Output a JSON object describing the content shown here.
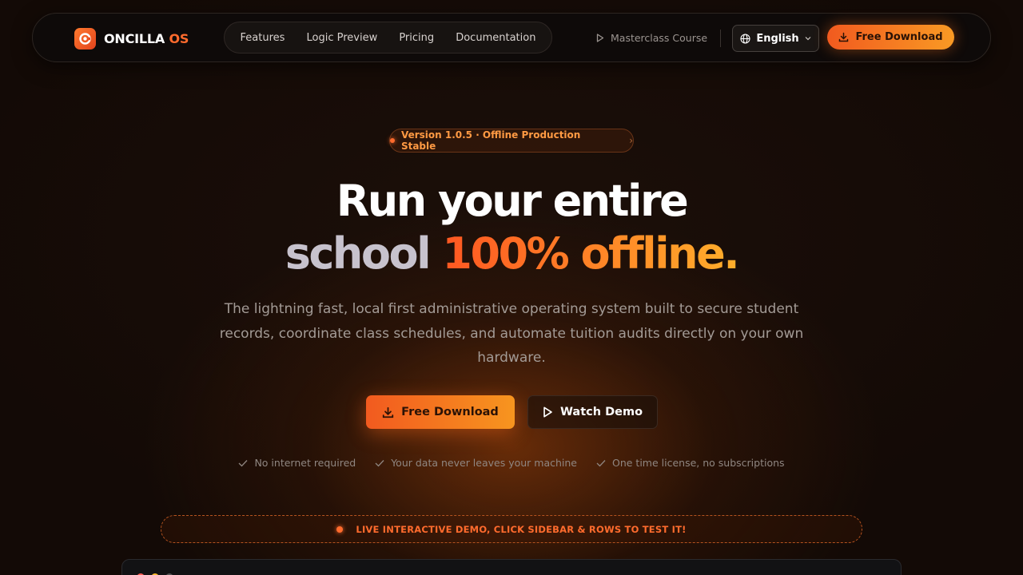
{
  "brand": {
    "name_main": "ONCILLA",
    "name_accent": "OS",
    "accent_color": "#ff6b2d"
  },
  "nav": {
    "links": [
      "Features",
      "Logic Preview",
      "Pricing",
      "Documentation"
    ],
    "masterclass": "Masterclass Course",
    "language": "English",
    "download_label": "Free Download"
  },
  "hero": {
    "badge": "Version 1.0.5 · Offline Production Stable",
    "title_line1": "Run your entire",
    "title_line2_plain": "school",
    "title_line2_accent": "100% offline.",
    "subtitle": "The lightning fast, local first administrative operating system built to secure student records, coordinate class schedules, and automate tuition audits directly on your own hardware.",
    "primary_cta": "Free Download",
    "secondary_cta": "Watch Demo",
    "checks": [
      "No internet required",
      "Your data never leaves your machine",
      "One time license, no subscriptions"
    ]
  },
  "live_banner": "LIVE INTERACTIVE DEMO, CLICK SIDEBAR & ROWS TO TEST IT!",
  "icons": [
    "logo-icon",
    "play-icon",
    "globe-icon",
    "chevron-down-icon",
    "download-icon",
    "check-icon",
    "sun-icon"
  ]
}
